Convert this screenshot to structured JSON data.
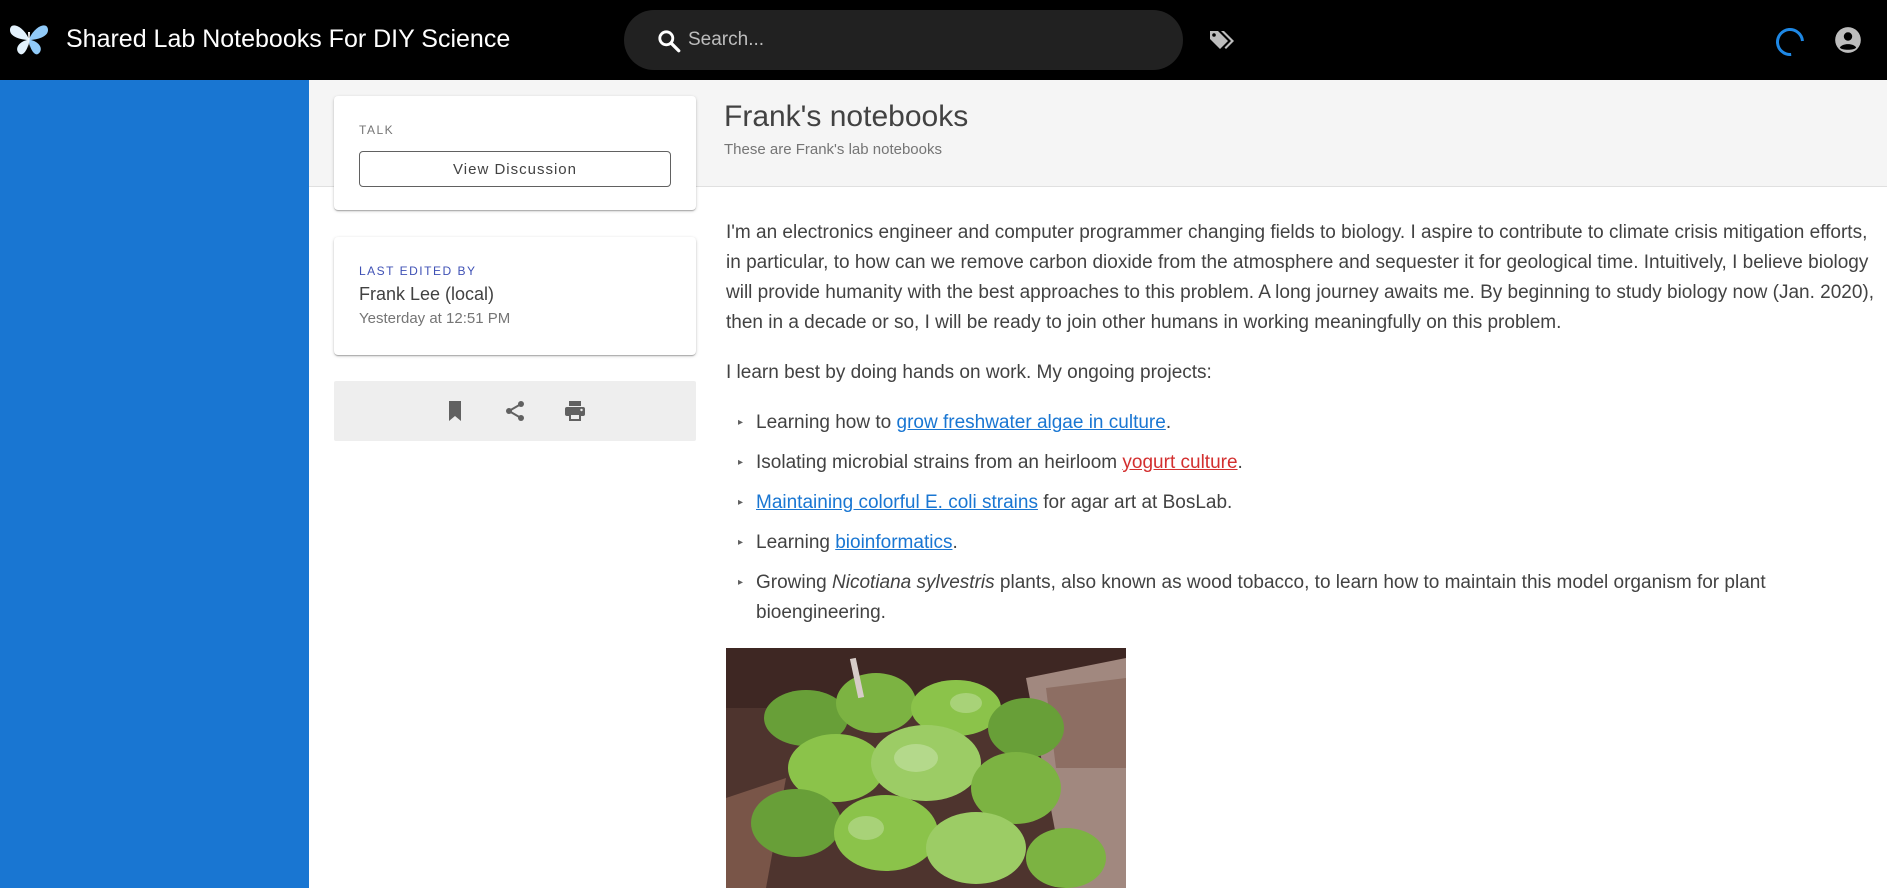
{
  "app": {
    "title": "Shared Lab Notebooks For DIY Science",
    "logo_icon": "butterfly-logo-icon"
  },
  "search": {
    "placeholder": "Search...",
    "icon": "search-icon"
  },
  "toolbar": {
    "tags_icon": "tags-icon",
    "loading_icon": "loading-spinner-icon",
    "account_icon": "account-circle-icon"
  },
  "page": {
    "title": "Frank's notebooks",
    "subtitle": "These are Frank's lab notebooks"
  },
  "talk_card": {
    "label": "TALK",
    "button_label": "View Discussion"
  },
  "edited_card": {
    "label": "LAST EDITED BY",
    "editor": "Frank Lee (local)",
    "time": "Yesterday at 12:51 PM"
  },
  "actions": {
    "icons": [
      "bookmark-icon",
      "share-icon",
      "print-icon"
    ]
  },
  "content": {
    "intro": "I'm an electronics engineer and computer programmer changing fields to biology. I aspire to contribute to climate crisis mitigation efforts, in particular, to how can we remove carbon dioxide from the atmosphere and sequester it for geological time. Intuitively, I believe biology will provide humanity with the best approaches to this problem. A long journey awaits me. By beginning to study biology now (Jan. 2020), then in a decade or so, I will be ready to join other humans in working meaningfully on this problem.",
    "projects_heading": "I learn best by doing hands on work. My ongoing projects:",
    "bullet_glyph": "▸",
    "items": [
      {
        "before": "Learning how to ",
        "link": "grow freshwater algae in culture",
        "after": "."
      },
      {
        "before": "Isolating microbial strains from an heirloom ",
        "link": "yogurt culture",
        "after": "."
      },
      {
        "before": "",
        "link": "Maintaining colorful E. coli strains",
        "after": " for agar art at BosLab."
      },
      {
        "before": "Learning ",
        "link": "bioinformatics",
        "after": "."
      },
      {
        "before": "Growing ",
        "italic": "Nicotiana sylvestris",
        "after": " plants, also known as wood tobacco, to learn how to maintain this model organism for plant bioengineering."
      }
    ]
  },
  "colors": {
    "topbar": "#000000",
    "sidebar": "#1976d2",
    "link": "#1976d2",
    "link_missing": "#d32f2f",
    "header_strip": "#f5f5f5"
  }
}
